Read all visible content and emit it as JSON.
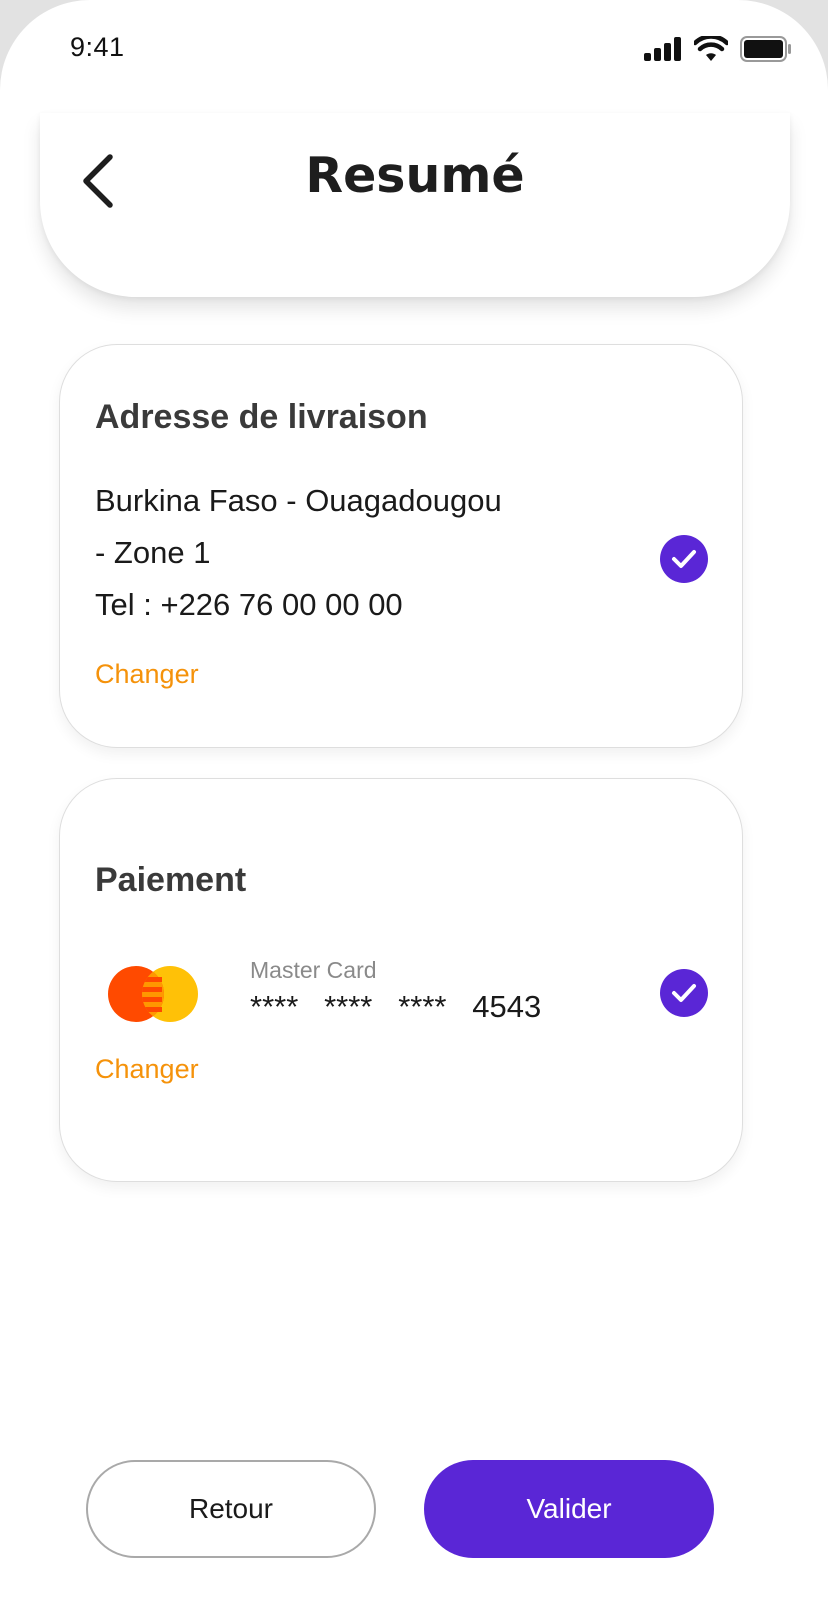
{
  "status_bar": {
    "time": "9:41",
    "icons": [
      "cellular-signal-icon",
      "wifi-icon",
      "battery-icon"
    ]
  },
  "header": {
    "title": "Resumé",
    "back_icon": "chevron-left-icon"
  },
  "address_card": {
    "title": "Adresse de livraison",
    "line1": "Burkina Faso - Ouagadougou",
    "line2": "- Zone 1",
    "phone": "Tel : +226 76 00 00 00",
    "change_label": "Changer",
    "selected": true
  },
  "payment_card": {
    "title": "Paiement",
    "card_brand": "Master Card",
    "card_number": "****   ****   ****   4543",
    "change_label": "Changer",
    "selected": true,
    "logo_icon": "mastercard-logo-icon"
  },
  "actions": {
    "back_label": "Retour",
    "validate_label": "Valider"
  },
  "colors": {
    "accent": "#5a26d6",
    "link": "#f5920a",
    "mastercard_red": "#ff4a00",
    "mastercard_yellow": "#ffc107"
  }
}
